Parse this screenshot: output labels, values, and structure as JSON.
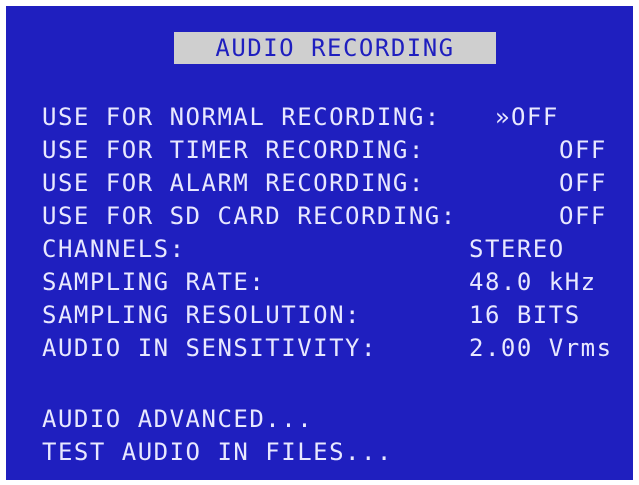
{
  "screen": {
    "title": "AUDIO RECORDING",
    "bg_color": "#1f1fbf",
    "text_color": "#e8e8ff",
    "title_bg_color": "#cfcfcf"
  },
  "settings": [
    {
      "label": "USE FOR NORMAL RECORDING:",
      "value": "»OFF"
    },
    {
      "label": "USE FOR TIMER RECORDING:",
      "value": "OFF"
    },
    {
      "label": "USE FOR ALARM RECORDING:",
      "value": "OFF"
    },
    {
      "label": "USE FOR SD CARD RECORDING:",
      "value": "OFF"
    },
    {
      "label": "CHANNELS:",
      "value": "STEREO"
    },
    {
      "label": "SAMPLING RATE:",
      "value": "48.0 kHz"
    },
    {
      "label": "SAMPLING RESOLUTION:",
      "value": "16 BITS"
    },
    {
      "label": "AUDIO IN SENSITIVITY:",
      "value": "2.00 Vrms"
    }
  ],
  "menu": [
    {
      "label": "AUDIO ADVANCED..."
    },
    {
      "label": "TEST AUDIO IN FILES..."
    }
  ]
}
